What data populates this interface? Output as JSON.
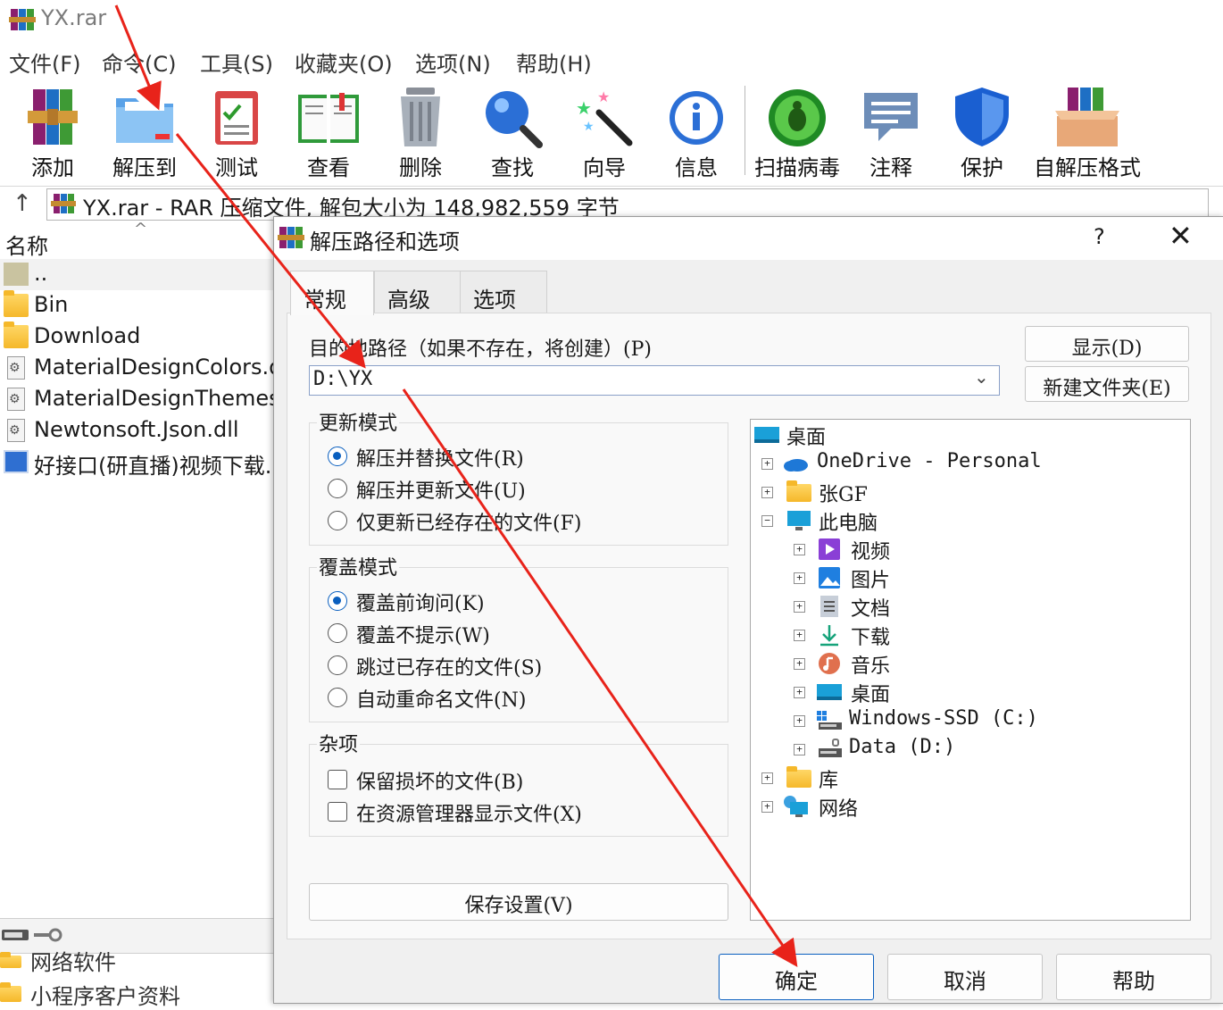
{
  "window": {
    "title": "YX.rar"
  },
  "menu": [
    "文件(F)",
    "命令(C)",
    "工具(S)",
    "收藏夹(O)",
    "选项(N)",
    "帮助(H)"
  ],
  "toolbar": [
    "添加",
    "解压到",
    "测试",
    "查看",
    "删除",
    "查找",
    "向导",
    "信息",
    "扫描病毒",
    "注释",
    "保护",
    "自解压格式"
  ],
  "pathbar": {
    "text": "YX.rar - RAR 压缩文件, 解包大小为 148,982,559 字节"
  },
  "filelist": {
    "header": "名称",
    "rows": [
      "..",
      "Bin",
      "Download",
      "MaterialDesignColors.dll",
      "MaterialDesignThemes.",
      "Newtonsoft.Json.dll",
      "好接口(研直播)视频下载..."
    ],
    "below": [
      "网络软件",
      "小程序客户资料"
    ]
  },
  "dialog": {
    "title": "解压路径和选项",
    "help": "?",
    "close": "✕",
    "tabs": [
      "常规",
      "高级",
      "选项"
    ],
    "dest_label": "目的地路径（如果不存在，将创建）(P)",
    "dest_value": "D:\\YX",
    "show_btn": "显示(D)",
    "newfolder_btn": "新建文件夹(E)",
    "update_group": {
      "title": "更新模式",
      "options": [
        "解压并替换文件(R)",
        "解压并更新文件(U)",
        "仅更新已经存在的文件(F)"
      ],
      "selected": 0
    },
    "overwrite_group": {
      "title": "覆盖模式",
      "options": [
        "覆盖前询问(K)",
        "覆盖不提示(W)",
        "跳过已存在的文件(S)",
        "自动重命名文件(N)"
      ],
      "selected": 0
    },
    "misc_group": {
      "title": "杂项",
      "options": [
        "保留损坏的文件(B)",
        "在资源管理器显示文件(X)"
      ]
    },
    "save_btn": "保存设置(V)",
    "tree": [
      "桌面",
      "OneDrive - Personal",
      "张GF",
      "此电脑",
      "视频",
      "图片",
      "文档",
      "下载",
      "音乐",
      "桌面",
      "Windows-SSD (C:)",
      "Data (D:)",
      "库",
      "网络"
    ],
    "ok": "确定",
    "cancel": "取消",
    "help_btn": "帮助"
  },
  "colors": {
    "accent": "#0a5fbf",
    "annotation": "#e8231a",
    "folder": "#f5b82a"
  }
}
